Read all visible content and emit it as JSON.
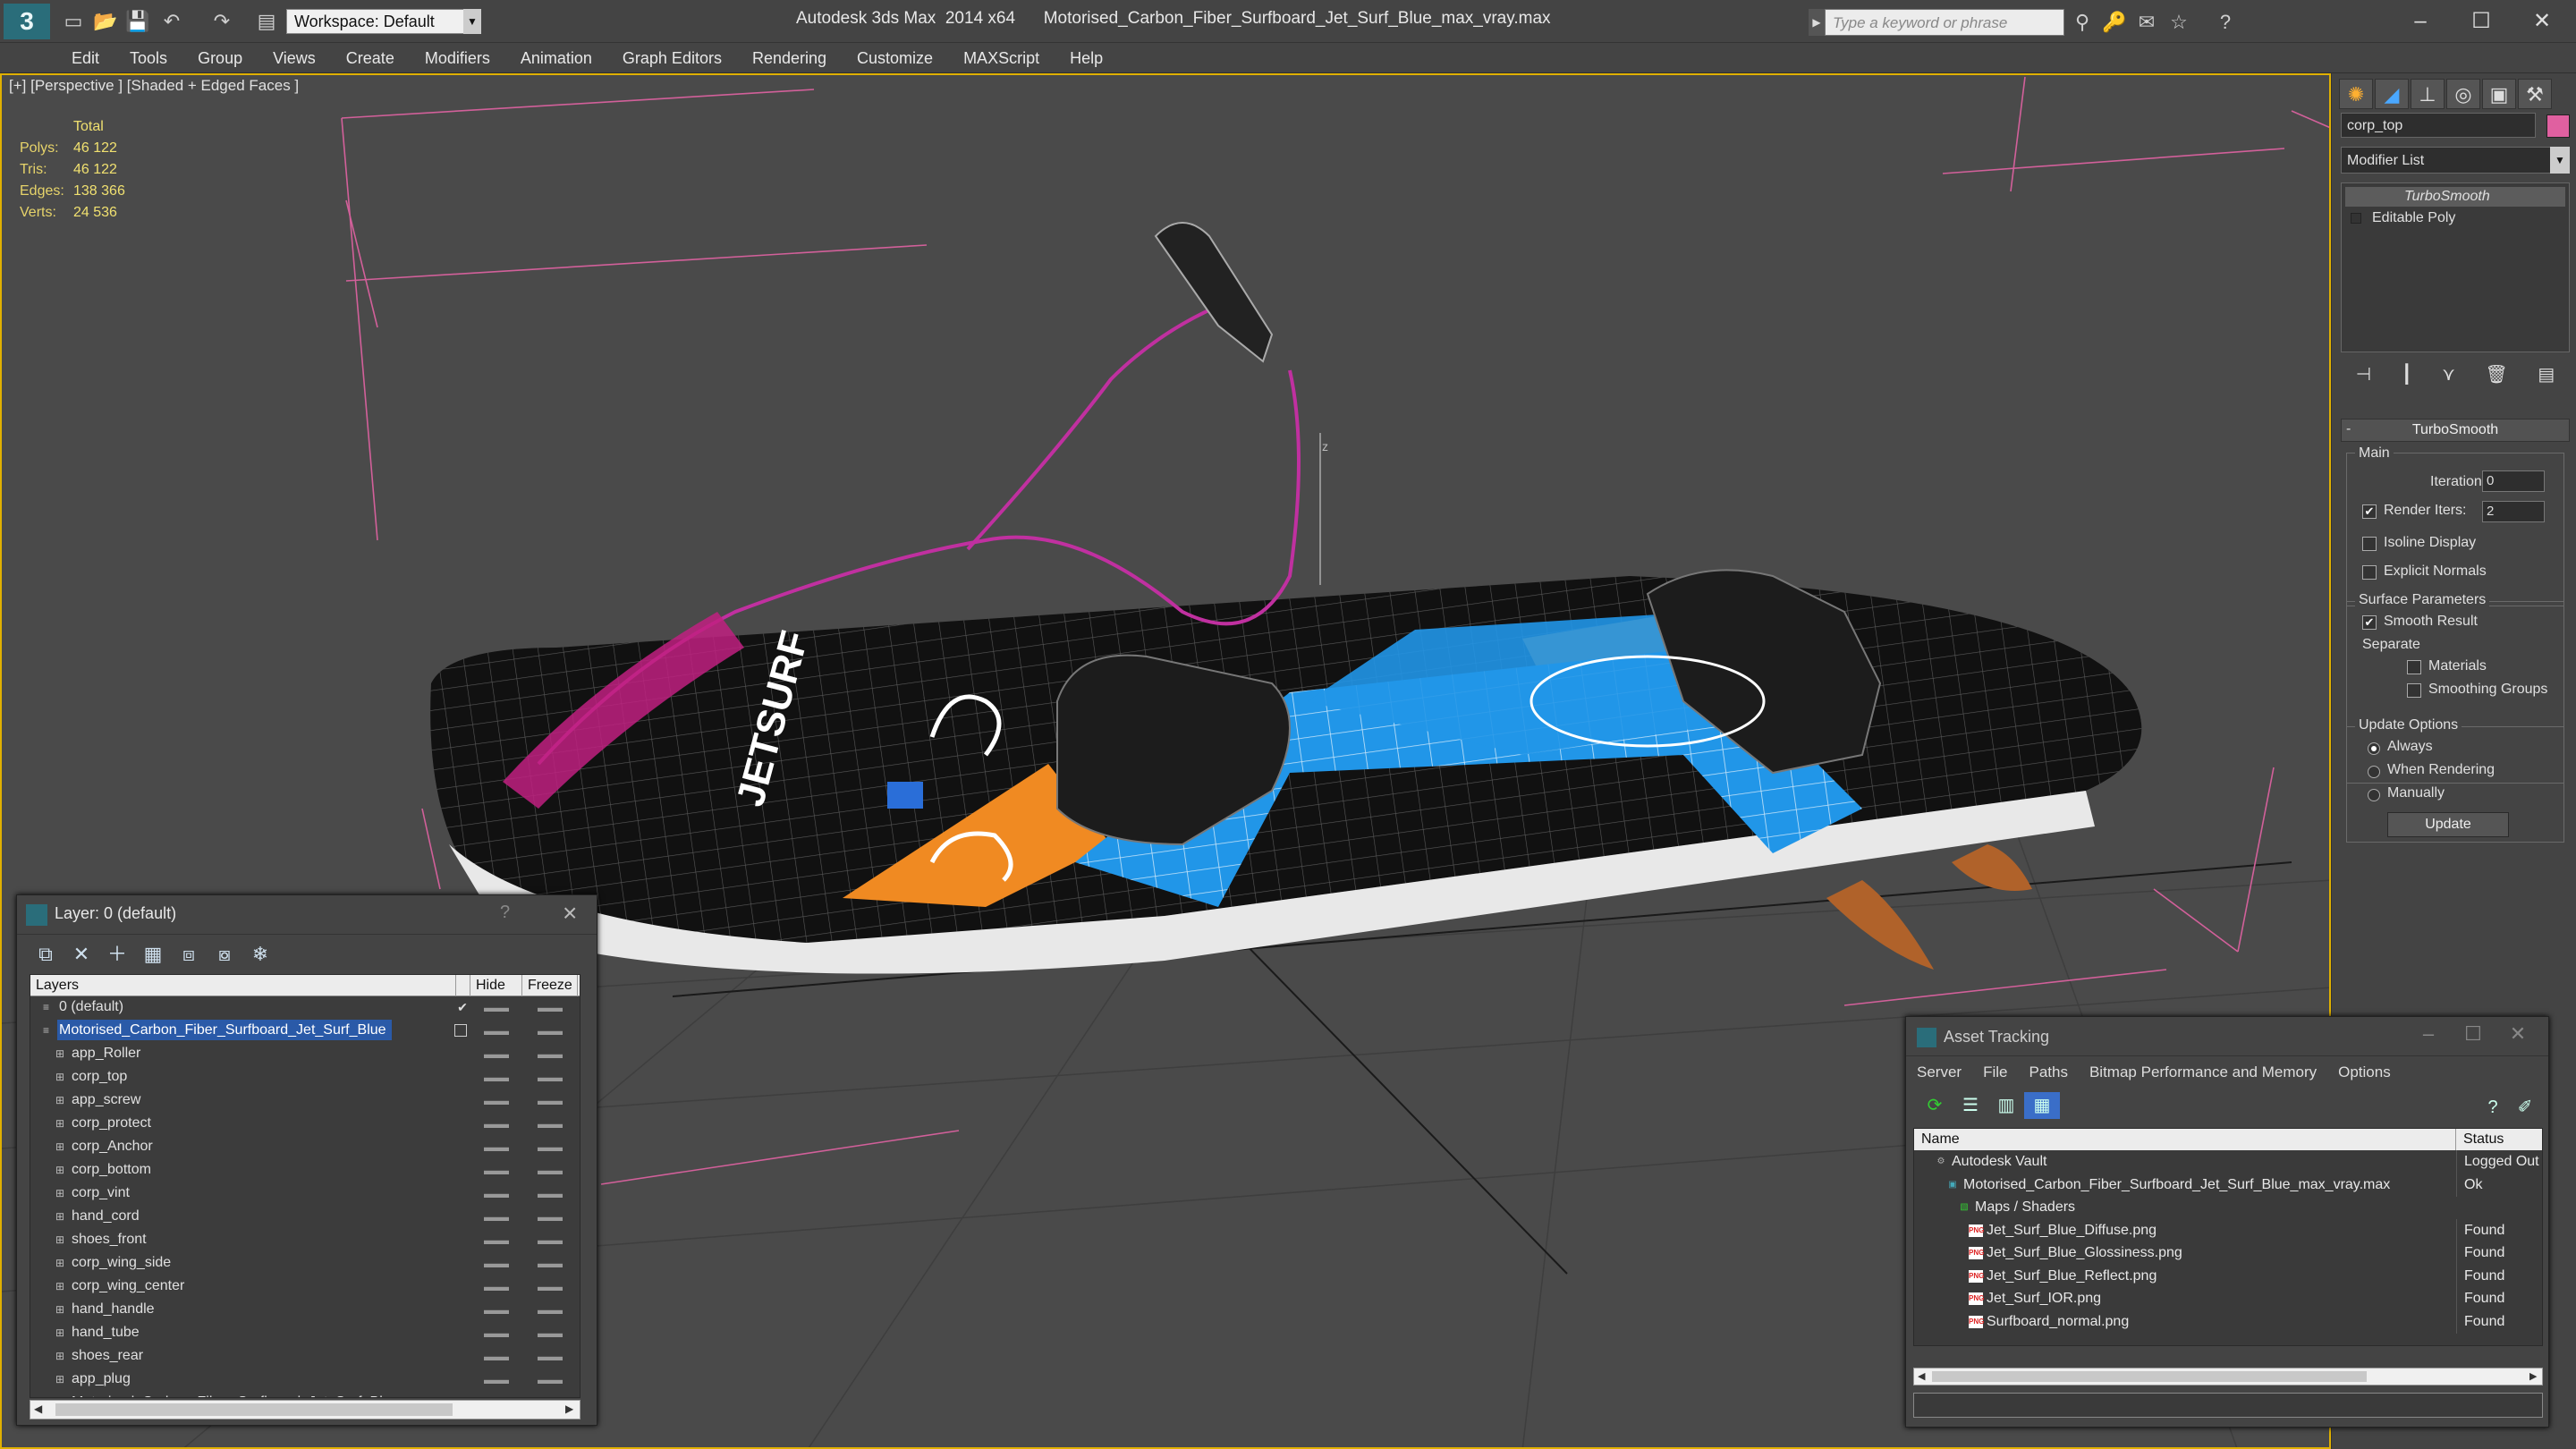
{
  "titlebar": {
    "workspace": "Workspace: Default",
    "app_name": "Autodesk 3ds Max  2014 x64",
    "file_name": "Motorised_Carbon_Fiber_Surfboard_Jet_Surf_Blue_max_vray.max",
    "search_placeholder": "Type a keyword or phrase",
    "logo_glyph": "3"
  },
  "menu": [
    "Edit",
    "Tools",
    "Group",
    "Views",
    "Create",
    "Modifiers",
    "Animation",
    "Graph Editors",
    "Rendering",
    "Customize",
    "MAXScript",
    "Help"
  ],
  "viewport": {
    "label": "[+] [Perspective ] [Shaded + Edged Faces ]",
    "stats": {
      "header": "Total",
      "rows": [
        {
          "k": "Polys:",
          "v": "46 122"
        },
        {
          "k": "Tris:",
          "v": "46 122"
        },
        {
          "k": "Edges:",
          "v": "138 366"
        },
        {
          "k": "Verts:",
          "v": "24 536"
        }
      ]
    },
    "board_text": "JETSURF",
    "axis_label": "z"
  },
  "command_panel": {
    "object_name": "corp_top",
    "object_color": "#e060a0",
    "modifier_list": "Modifier List",
    "stack": [
      "TurboSmooth",
      "Editable Poly"
    ],
    "rollout_title": "TurboSmooth",
    "main_label": "Main",
    "iterations_label": "Iterations:",
    "iterations_value": "0",
    "render_iters_label": "Render Iters:",
    "render_iters_value": "2",
    "isoline_label": "Isoline Display",
    "explicit_normals_label": "Explicit Normals",
    "surface_params_label": "Surface Parameters",
    "smooth_result_label": "Smooth Result",
    "separate_label": "Separate",
    "materials_label": "Materials",
    "smoothing_groups_label": "Smoothing Groups",
    "update_options_label": "Update Options",
    "always_label": "Always",
    "when_rendering_label": "When Rendering",
    "manually_label": "Manually",
    "update_button": "Update"
  },
  "layer_window": {
    "title": "Layer: 0 (default)",
    "help": "?",
    "columns": {
      "layers": "Layers",
      "hide": "Hide",
      "freeze": "Freeze"
    },
    "rows": [
      {
        "name": "0 (default)",
        "indent": 1,
        "check": "✔"
      },
      {
        "name": "Motorised_Carbon_Fiber_Surfboard_Jet_Surf_Blue",
        "indent": 1,
        "selected": true
      },
      {
        "name": "app_Roller",
        "indent": 2
      },
      {
        "name": "corp_top",
        "indent": 2
      },
      {
        "name": "app_screw",
        "indent": 2
      },
      {
        "name": "corp_protect",
        "indent": 2
      },
      {
        "name": "corp_Anchor",
        "indent": 2
      },
      {
        "name": "corp_bottom",
        "indent": 2
      },
      {
        "name": "corp_vint",
        "indent": 2
      },
      {
        "name": "hand_cord",
        "indent": 2
      },
      {
        "name": "shoes_front",
        "indent": 2
      },
      {
        "name": "corp_wing_side",
        "indent": 2
      },
      {
        "name": "corp_wing_center",
        "indent": 2
      },
      {
        "name": "hand_handle",
        "indent": 2
      },
      {
        "name": "hand_tube",
        "indent": 2
      },
      {
        "name": "shoes_rear",
        "indent": 2
      },
      {
        "name": "app_plug",
        "indent": 2
      },
      {
        "name": "Motorised_Carbon_Fiber_Surfboard_Jet_Surf_Blue",
        "indent": 2
      }
    ],
    "dash": "▬▬"
  },
  "asset_window": {
    "title": "Asset Tracking",
    "menu": [
      "Server",
      "File",
      "Paths",
      "Bitmap Performance and Memory",
      "Options"
    ],
    "columns": {
      "name": "Name",
      "status": "Status"
    },
    "rows": [
      {
        "name": "Autodesk Vault",
        "status": "Logged Out",
        "indent": 0,
        "icon": "vault"
      },
      {
        "name": "Motorised_Carbon_Fiber_Surfboard_Jet_Surf_Blue_max_vray.max",
        "status": "Ok",
        "indent": 1,
        "icon": "max"
      },
      {
        "name": "Maps / Shaders",
        "status": "",
        "indent": 2,
        "icon": "maps"
      },
      {
        "name": "Jet_Surf_Blue_Diffuse.png",
        "status": "Found",
        "indent": 3,
        "icon": "png"
      },
      {
        "name": "Jet_Surf_Blue_Glossiness.png",
        "status": "Found",
        "indent": 3,
        "icon": "png"
      },
      {
        "name": "Jet_Surf_Blue_Reflect.png",
        "status": "Found",
        "indent": 3,
        "icon": "png"
      },
      {
        "name": "Jet_Surf_IOR.png",
        "status": "Found",
        "indent": 3,
        "icon": "png"
      },
      {
        "name": "Surfboard_normal.png",
        "status": "Found",
        "indent": 3,
        "icon": "png"
      }
    ],
    "png_label": "PNG"
  }
}
